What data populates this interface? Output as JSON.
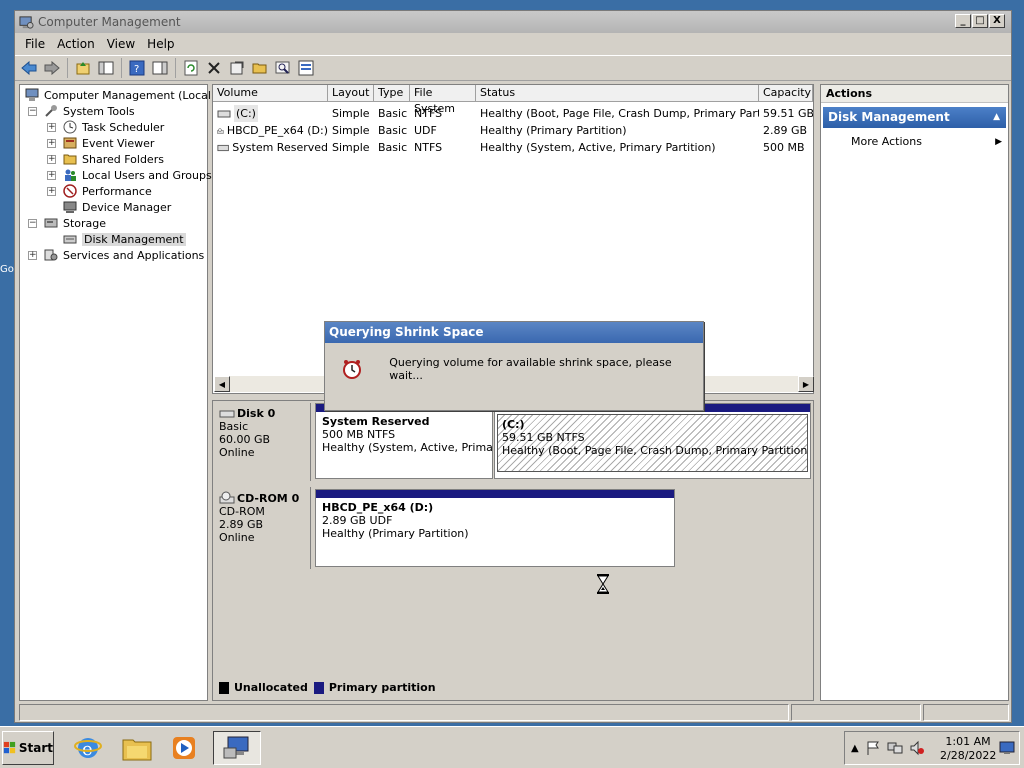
{
  "window": {
    "title": "Computer Management",
    "controls": {
      "minimize": "_",
      "maximize": "□",
      "close": "X"
    }
  },
  "menu": [
    "File",
    "Action",
    "View",
    "Help"
  ],
  "tree": {
    "root": "Computer Management (Local)",
    "system_tools": "System Tools",
    "task_scheduler": "Task Scheduler",
    "event_viewer": "Event Viewer",
    "shared_folders": "Shared Folders",
    "local_users": "Local Users and Groups",
    "performance": "Performance",
    "device_manager": "Device Manager",
    "storage": "Storage",
    "disk_management": "Disk Management",
    "services_apps": "Services and Applications"
  },
  "volumes": {
    "headers": [
      "Volume",
      "Layout",
      "Type",
      "File System",
      "Status",
      "Capacity"
    ],
    "rows": [
      [
        "(C:)",
        "Simple",
        "Basic",
        "NTFS",
        "Healthy (Boot, Page File, Crash Dump, Primary Partition)",
        "59.51 GB"
      ],
      [
        "HBCD_PE_x64 (D:)",
        "Simple",
        "Basic",
        "UDF",
        "Healthy (Primary Partition)",
        "2.89 GB"
      ],
      [
        "System Reserved",
        "Simple",
        "Basic",
        "NTFS",
        "Healthy (System, Active, Primary Partition)",
        "500 MB"
      ]
    ]
  },
  "disks": {
    "disk0": {
      "name": "Disk 0",
      "type": "Basic",
      "size": "60.00 GB",
      "state": "Online"
    },
    "cdrom0": {
      "name": "CD-ROM 0",
      "type": "CD-ROM",
      "size": "2.89 GB",
      "state": "Online"
    },
    "p_sysres": {
      "name": "System Reserved",
      "size": "500 MB NTFS",
      "status": "Healthy (System, Active, Primary I"
    },
    "p_c": {
      "name": "(C:)",
      "size": "59.51 GB NTFS",
      "status": "Healthy (Boot, Page File, Crash Dump, Primary Partition)"
    },
    "p_d": {
      "name": "HBCD_PE_x64  (D:)",
      "size": "2.89 GB UDF",
      "status": "Healthy (Primary Partition)"
    }
  },
  "legend": {
    "unallocated": "Unallocated",
    "primary": "Primary partition"
  },
  "actions": {
    "header": "Actions",
    "section": "Disk Management",
    "more": "More Actions"
  },
  "dialog": {
    "title": "Querying Shrink Space",
    "message": "Querying volume for available shrink space, please wait..."
  },
  "taskbar": {
    "start": "Start",
    "time": "1:01 AM",
    "date": "2/28/2022"
  },
  "desktop_fragment": "Go",
  "colors": {
    "primary_partition": "#1a1a80",
    "unallocated": "#000000",
    "selection": "#2d5fa8"
  }
}
